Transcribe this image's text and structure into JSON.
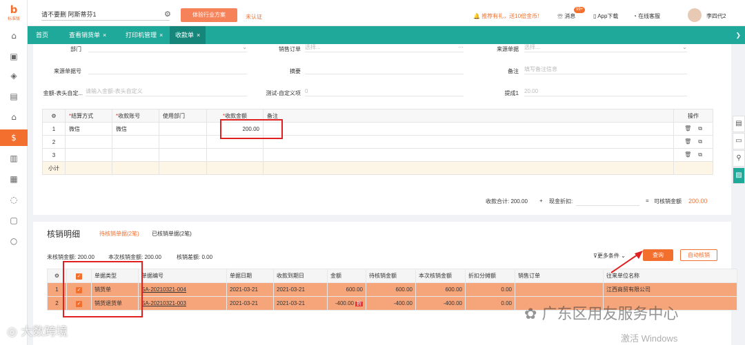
{
  "logo": {
    "mark": "b",
    "text": "标准版"
  },
  "header": {
    "company": "请不要删 阿斯蒂芬1",
    "industry_btn": "体验行业方案",
    "uncertified": "未认证",
    "promo": "推荐有礼，送10倍金币!",
    "messages": "消息",
    "msg_badge": "99+",
    "app": "App下载",
    "service": "在线客服",
    "user": "李四代2"
  },
  "tabs": [
    "首页",
    "查看销货单",
    "打印机管理",
    "收款单"
  ],
  "form": {
    "dept_label": "部门",
    "sales_order_label": "销售订单",
    "sales_order_ph": "选择...",
    "source_type_label": "来源单据",
    "source_type_ph": "选择...",
    "source_no_label": "来源单据号",
    "summary_label": "摘要",
    "remark_label": "备注",
    "remark_ph": "填写备注信息",
    "amt_custom_label": "金额-表头自定...",
    "amt_custom_ph": "请输入金额-表头自定义",
    "test_custom_label": "测试-自定义项",
    "test_custom_val": "0",
    "ticheng_label": "提成1",
    "ticheng_val": "20.00"
  },
  "grid": {
    "headers": [
      "结算方式",
      "收款账号",
      "使用部门",
      "收款金额",
      "备注",
      "操作"
    ],
    "rows": [
      {
        "no": "1",
        "method": "微信",
        "account": "微信",
        "dept": "",
        "amount": "200.00",
        "note": ""
      },
      {
        "no": "2",
        "method": "",
        "account": "",
        "dept": "",
        "amount": "",
        "note": ""
      },
      {
        "no": "3",
        "method": "",
        "account": "",
        "dept": "",
        "amount": "",
        "note": ""
      }
    ],
    "subtotal": "小计"
  },
  "totals": {
    "recv_label": "收款合计:",
    "recv_val": "200.00",
    "plus": "+",
    "cash_label": "现金折扣:",
    "eq": "=",
    "avail_label": "可核销金额",
    "avail_val": "200.00"
  },
  "verify": {
    "title": "核销明细",
    "tab_pending": "待核销单据(2笔)",
    "tab_done": "已核销单据(2笔)",
    "stat1": "未核销金额: 200.00",
    "stat2": "本次核销金额: 200.00",
    "stat3": "核销差额: 0.00",
    "more": "更多条件",
    "query": "查询",
    "auto": "自动核销",
    "headers": [
      "单据类型",
      "单据编号",
      "单据日期",
      "收款到期日",
      "金额",
      "待核销金额",
      "本次核销金额",
      "折扣分摊额",
      "销售订单",
      "往来单位名称"
    ],
    "rows": [
      {
        "no": "1",
        "type": "销货单",
        "code": "SA-20210321-004",
        "date": "2021-03-21",
        "due": "2021-03-21",
        "amount": "600.00",
        "pending": "600.00",
        "current": "600.00",
        "discount": "0.00",
        "order": "",
        "partner": "江西商贸有限公司"
      },
      {
        "no": "2",
        "type": "销货退货单",
        "code": "SA-20210321-003",
        "date": "2021-03-21",
        "due": "2021-03-21",
        "amount": "-400.00",
        "pending": "-400.00",
        "current": "-400.00",
        "discount": "0.00",
        "order": "",
        "partner": ""
      }
    ],
    "zhe": "折"
  },
  "watermarks": {
    "wm1": "广东区用友服务中心",
    "wm2": "激活 Windows",
    "wm3": "大数跨境"
  },
  "colors": {
    "accent": "#f36f2d",
    "teal": "#1fa99a"
  }
}
